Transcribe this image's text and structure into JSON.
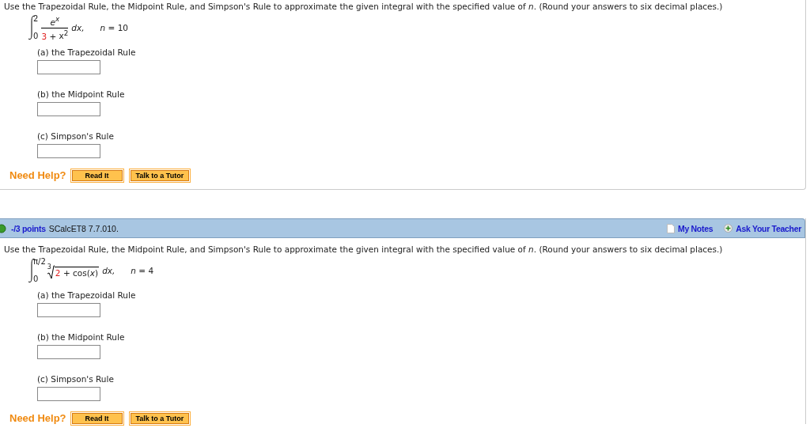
{
  "questions": [
    {
      "instruction": "Use the Trapezoidal Rule, the Midpoint Rule, and Simpson's Rule to approximate the given integral with the specified value of *n*. (Round your answers to six decimal places.)",
      "integral": {
        "kind": "fraction",
        "lower": "0",
        "upper": "2",
        "numerator": "e$^{x}$",
        "denominator": [
          {
            "text": "3",
            "highlight": true
          },
          {
            "text": " + ",
            "highlight": false
          },
          {
            "text": "x$^{2}$",
            "highlight": false
          }
        ],
        "differential": "dx,",
        "n": "*n* = 10"
      },
      "parts": [
        {
          "label": "(a) the Trapezoidal Rule"
        },
        {
          "label": "(b) the Midpoint Rule"
        },
        {
          "label": "(c) Simpson's Rule"
        }
      ],
      "help": {
        "label": "Need Help?",
        "buttons": [
          "Read It",
          "Talk to a Tutor"
        ]
      }
    },
    {
      "header": {
        "points": "-/3 points",
        "code": "SCalcET8 7.7.010.",
        "links": [
          {
            "kind": "notes",
            "label": "My Notes"
          },
          {
            "kind": "ask",
            "label": "Ask Your Teacher"
          }
        ]
      },
      "instruction": "Use the Trapezoidal Rule, the Midpoint Rule, and Simpson's Rule to approximate the given integral with the specified value of *n*. (Round your answers to six decimal places.)",
      "integral": {
        "kind": "root",
        "lower": "0",
        "upper": "π/2",
        "index": "3",
        "radicand": [
          {
            "text": "2",
            "highlight": true
          },
          {
            "text": " + cos(",
            "highlight": false
          },
          {
            "text": "x",
            "highlight": false
          },
          {
            "text": ")",
            "highlight": false
          }
        ],
        "differential": "dx,",
        "n": "*n* = 4"
      },
      "parts": [
        {
          "label": "(a) the Trapezoidal Rule"
        },
        {
          "label": "(b) the Midpoint Rule"
        },
        {
          "label": "(c) Simpson's Rule"
        }
      ],
      "help": {
        "label": "Need Help?",
        "buttons": [
          "Read It",
          "Talk to a Tutor"
        ]
      }
    }
  ]
}
